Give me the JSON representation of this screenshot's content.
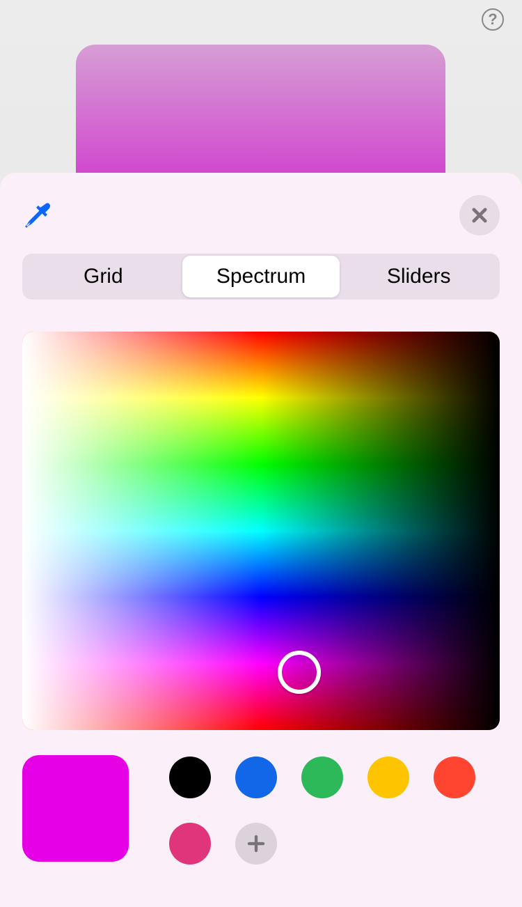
{
  "header": {
    "help_icon": "help-icon"
  },
  "preview": {
    "color": "#d142ce"
  },
  "picker": {
    "eyedropper_icon": "eyedropper-icon",
    "close_icon": "close-icon",
    "tabs": [
      {
        "label": "Grid",
        "active": false
      },
      {
        "label": "Spectrum",
        "active": true
      },
      {
        "label": "Sliders",
        "active": false
      }
    ],
    "spectrum": {
      "cursor_position": {
        "x_pct": 58,
        "y_pct": 85.5
      }
    },
    "current_color": "#e600e6",
    "presets": [
      {
        "color": "#000000"
      },
      {
        "color": "#1266e8"
      },
      {
        "color": "#2db859"
      },
      {
        "color": "#ffc400"
      },
      {
        "color": "#ff4530"
      },
      {
        "color": "#e0357a"
      }
    ],
    "add_icon": "plus-icon"
  }
}
